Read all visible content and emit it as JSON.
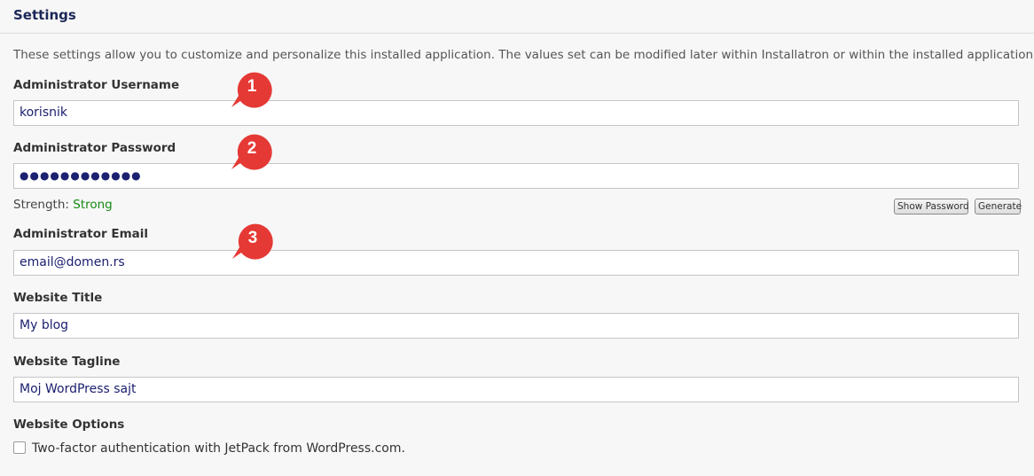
{
  "header": {
    "title": "Settings"
  },
  "intro_text": "These settings allow you to customize and personalize this installed application. The values set can be modified later within Installatron or within the installed application.",
  "fields": {
    "username": {
      "label": "Administrator Username",
      "value": "korisnik"
    },
    "password": {
      "label": "Administrator Password",
      "value": "●●●●●●●●●●●●"
    },
    "email": {
      "label": "Administrator Email",
      "value": "email@domen.rs"
    },
    "title": {
      "label": "Website Title",
      "value": "My blog"
    },
    "tagline": {
      "label": "Website Tagline",
      "value": "Moj WordPress sajt"
    }
  },
  "strength": {
    "label": "Strength:",
    "value": "Strong",
    "color": "#148a14"
  },
  "buttons": {
    "show_password": "Show Password",
    "generate": "Generate"
  },
  "options": {
    "label": "Website Options",
    "checkbox_label": "Two-factor authentication with JetPack from WordPress.com.",
    "checked": false
  },
  "markers": [
    {
      "number": "1",
      "color": "#e53935"
    },
    {
      "number": "2",
      "color": "#e53935"
    },
    {
      "number": "3",
      "color": "#e53935"
    }
  ]
}
